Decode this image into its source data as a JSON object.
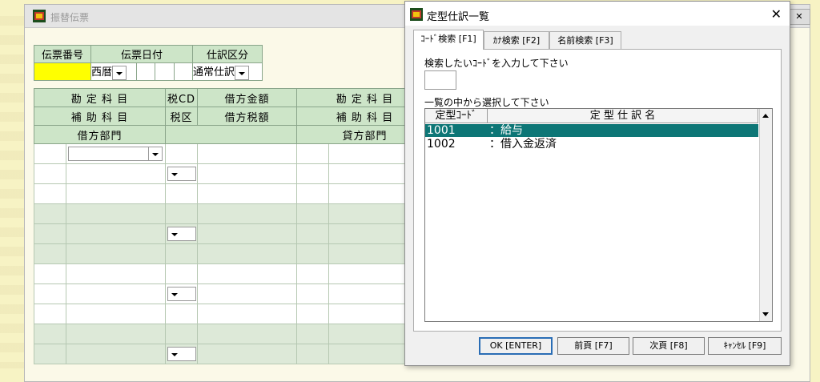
{
  "background_window": {
    "title": "振替伝票",
    "header": {
      "voucher_no_label": "伝票番号",
      "voucher_date_label": "伝票日付",
      "entry_type_label": "仕訳区分",
      "era_value": "西暦",
      "entry_type_value": "通常仕訳"
    },
    "grid": {
      "row1": [
        "勘 定 科 目",
        "税CD",
        "借方金額",
        "勘 定 科 目"
      ],
      "row2": [
        "補 助 科 目",
        "税区",
        "借方税額",
        "補 助 科 目"
      ],
      "row3": [
        "借方部門",
        "貸方部門"
      ]
    }
  },
  "dialog": {
    "title": "定型仕訳一覧",
    "tabs": [
      "ｺｰﾄﾞ検索 [F1]",
      "ｶﾅ検索 [F2]",
      "名前検索 [F3]"
    ],
    "code_prompt": "検索したいｺｰﾄﾞを入力して下さい",
    "code_value": "",
    "list_prompt": "一覧の中から選択して下さい",
    "list_headers": [
      "定型ｺｰﾄﾞ",
      "定 型 仕 訳 名"
    ],
    "rows": [
      {
        "code": "1001",
        "name": "：給与",
        "selected": true
      },
      {
        "code": "1002",
        "name": "：借入金返済",
        "selected": false
      }
    ],
    "buttons": [
      "OK [ENTER]",
      "前頁 [F7]",
      "次頁 [F8]",
      "ｷｬﾝｾﾙ [F9]"
    ]
  },
  "colors": {
    "highlight_yellow": "#ffff00",
    "selection_teal": "#0d7676",
    "header_green": "#cde5c8",
    "desktop": "#f7f3c4"
  },
  "icons": [
    "app-icon",
    "close-icon",
    "dropdown-arrow-icon",
    "scroll-up-icon",
    "scroll-down-icon"
  ]
}
